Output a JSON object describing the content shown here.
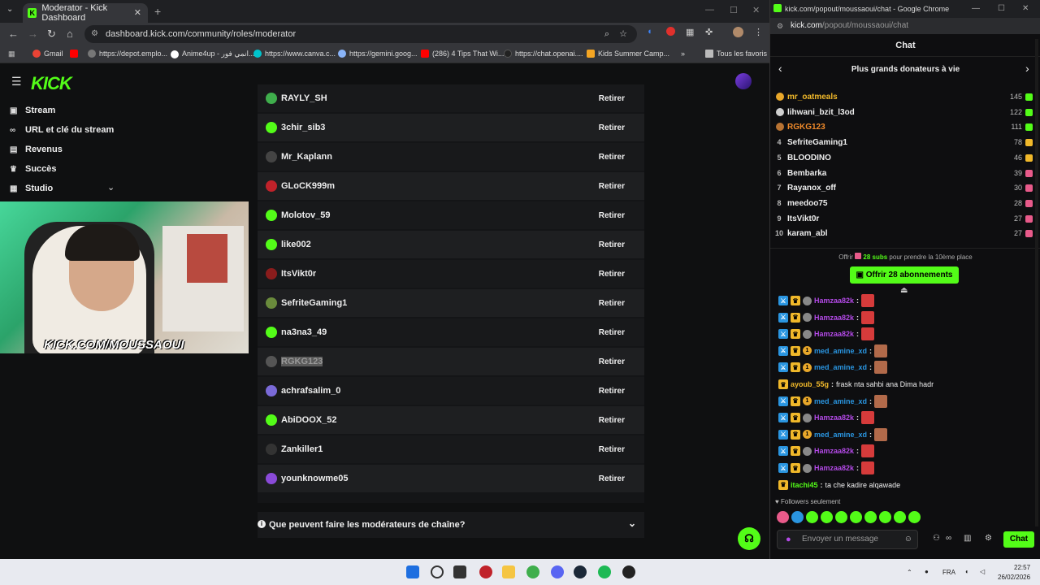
{
  "left_window": {
    "tab_title": "Moderator - Kick Dashboard",
    "url": "dashboard.kick.com/community/roles/moderator",
    "bookmarks": [
      {
        "label": "Gmail",
        "color": "#ea4335"
      },
      {
        "label": "",
        "color": "#ff0000"
      },
      {
        "label": "https://depot.emplo...",
        "color": "#cccccc"
      },
      {
        "label": "Anime4up - انمي فور...",
        "color": "#ffffff"
      },
      {
        "label": "https://www.canva.c...",
        "color": "#00c4cc"
      },
      {
        "label": "https://gemini.goog...",
        "color": "#8ab4f8"
      },
      {
        "label": "(286) 4 Tips That Wi...",
        "color": "#ff0000"
      },
      {
        "label": "https://chat.openai....",
        "color": "#222222"
      },
      {
        "label": "Kids Summer Camp...",
        "color": "#f5a623"
      }
    ],
    "bookmarks_all": "Tous les favoris",
    "logo": "KICK",
    "nav": [
      "Stream",
      "URL et clé du stream",
      "Revenus",
      "Succès",
      "Studio"
    ],
    "webcam_banner": "KICK.COM/MOUSSAOUI",
    "moderators": [
      {
        "name": "RAYLY_SH",
        "color": "#3fae4c"
      },
      {
        "name": "3chir_sib3",
        "color": "#53fc18"
      },
      {
        "name": "Mr_Kaplann",
        "color": "#444444"
      },
      {
        "name": "GLoCK999m",
        "color": "#c0222a"
      },
      {
        "name": "Molotov_59",
        "color": "#53fc18"
      },
      {
        "name": "like002",
        "color": "#53fc18"
      },
      {
        "name": "ItsVikt0r",
        "color": "#8a1c1c"
      },
      {
        "name": "SefriteGaming1",
        "color": "#6a8b3c"
      },
      {
        "name": "na3na3_49",
        "color": "#53fc18"
      },
      {
        "name": "RGKG123",
        "color": "#555555"
      },
      {
        "name": "achrafsalim_0",
        "color": "#7a6ad8"
      },
      {
        "name": "AbiDOOX_52",
        "color": "#53fc18"
      },
      {
        "name": "Zankiller1",
        "color": "#333333"
      },
      {
        "name": "younknowme05",
        "color": "#8a4ad8"
      }
    ],
    "remove_label": "Retirer",
    "faq": "Que peuvent faire les modérateurs de chaîne?"
  },
  "right_window": {
    "title": "kick.com/popout/moussaoui/chat - Google Chrome",
    "url_host": "kick.com",
    "url_path": "/popout/moussaoui/chat",
    "chat_header": "Chat",
    "leaderboard_title": "Plus grands donateurs à vie",
    "leaderboard": [
      {
        "rank": "1",
        "name": "mr_oatmeals",
        "value": "145",
        "name_color": "#f0b82a",
        "medal": "#e8a72a",
        "gift": "#53fc18"
      },
      {
        "rank": "2",
        "name": "lihwani_bzit_l3od",
        "value": "122",
        "name_color": "#eeeeee",
        "medal": "#cfcfcf",
        "gift": "#53fc18"
      },
      {
        "rank": "3",
        "name": "RGKG123",
        "value": "111",
        "name_color": "#f08a2a",
        "medal": "#b87333",
        "gift": "#53fc18"
      },
      {
        "rank": "4",
        "name": "SefriteGaming1",
        "value": "78",
        "name_color": "#eeeeee",
        "medal": "",
        "gift": "#f0b82a"
      },
      {
        "rank": "5",
        "name": "BLOODINO",
        "value": "46",
        "name_color": "#eeeeee",
        "medal": "",
        "gift": "#f0b82a"
      },
      {
        "rank": "6",
        "name": "Bembarka",
        "value": "39",
        "name_color": "#eeeeee",
        "medal": "",
        "gift": "#e85a8a"
      },
      {
        "rank": "7",
        "name": "Rayanox_off",
        "value": "30",
        "name_color": "#eeeeee",
        "medal": "",
        "gift": "#e85a8a"
      },
      {
        "rank": "8",
        "name": "meedoo75",
        "value": "28",
        "name_color": "#eeeeee",
        "medal": "",
        "gift": "#e85a8a"
      },
      {
        "rank": "9",
        "name": "ItsVikt0r",
        "value": "27",
        "name_color": "#eeeeee",
        "medal": "",
        "gift": "#e85a8a"
      },
      {
        "rank": "10",
        "name": "karam_abl",
        "value": "27",
        "name_color": "#eeeeee",
        "medal": "",
        "gift": "#e85a8a"
      }
    ],
    "offer_prefix": "Offrir",
    "offer_subs": "28 subs",
    "offer_suffix": "pour prendre la 10ème place",
    "offer_button": "Offrir 28 abonnements",
    "chat_messages": [
      {
        "user": "Hamzaa82k",
        "color": "#b44ae8",
        "text": "",
        "emote": "#d63b3b"
      },
      {
        "user": "Hamzaa82k",
        "color": "#b44ae8",
        "text": "",
        "emote": "#d63b3b"
      },
      {
        "user": "Hamzaa82k",
        "color": "#b44ae8",
        "text": "",
        "emote": "#d63b3b"
      },
      {
        "user": "med_amine_xd",
        "color": "#2a95e0",
        "text": "",
        "emote": "#b26a4a"
      },
      {
        "user": "med_amine_xd",
        "color": "#2a95e0",
        "text": "",
        "emote": "#b26a4a"
      },
      {
        "user": "ayoub_55g",
        "color": "#f0b82a",
        "text": "frask nta sahbi ana Dima hadr",
        "emote": ""
      },
      {
        "user": "med_amine_xd",
        "color": "#2a95e0",
        "text": "",
        "emote": "#b26a4a"
      },
      {
        "user": "Hamzaa82k",
        "color": "#b44ae8",
        "text": "",
        "emote": "#d63b3b"
      },
      {
        "user": "med_amine_xd",
        "color": "#2a95e0",
        "text": "",
        "emote": "#b26a4a"
      },
      {
        "user": "Hamzaa82k",
        "color": "#b44ae8",
        "text": "",
        "emote": "#d63b3b"
      },
      {
        "user": "Hamzaa82k",
        "color": "#b44ae8",
        "text": "",
        "emote": "#d63b3b"
      },
      {
        "user": "itachi45",
        "color": "#53fc18",
        "text": "ta che kadire alqawade",
        "emote": ""
      }
    ],
    "followers_only": "Followers seulement",
    "input_placeholder": "Envoyer un message",
    "send_label": "Chat"
  },
  "taskbar": {
    "lang": "FRA",
    "time": "22:57",
    "date": "26/02/2026"
  }
}
